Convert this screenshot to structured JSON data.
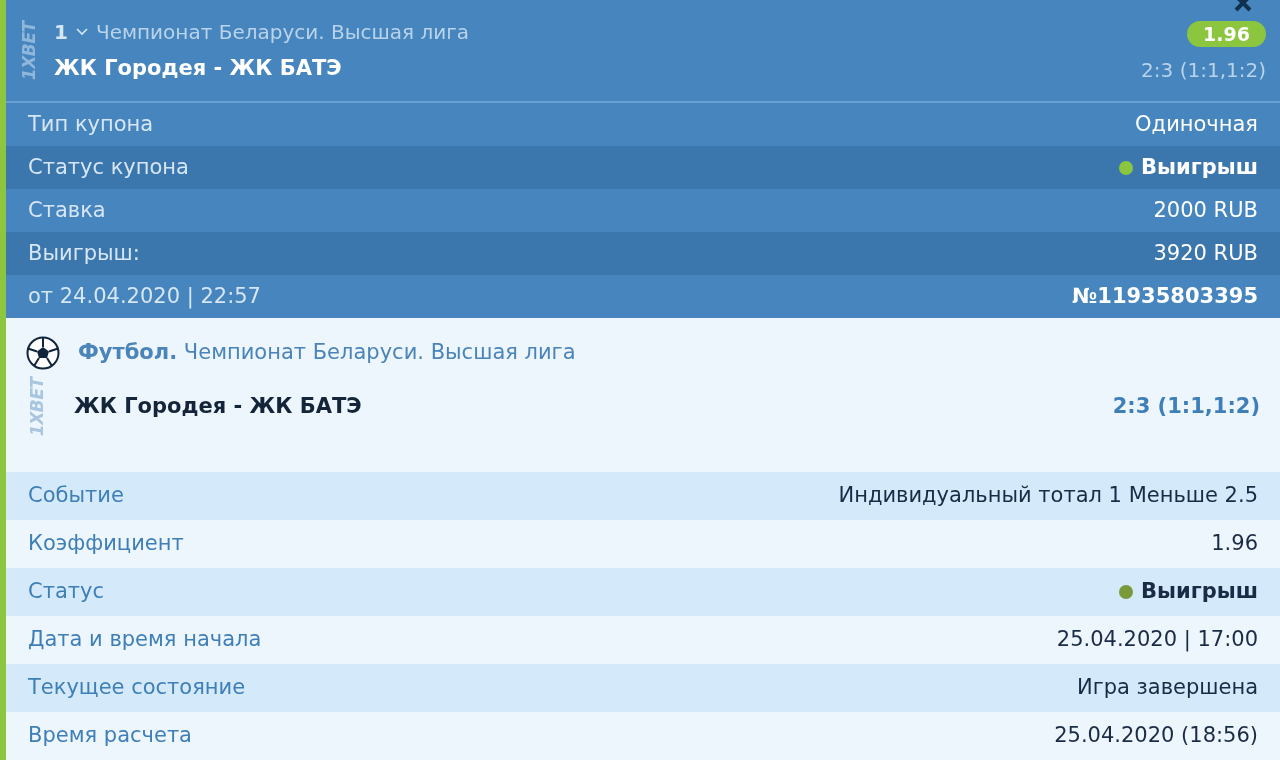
{
  "coupon": {
    "index": "1",
    "logo": "1XBET",
    "league": "Чемпионат Беларуси. Высшая лига",
    "match": "ЖК Городея - ЖК БАТЭ",
    "odds": "1.96",
    "score": "2:3 (1:1,1:2)",
    "rows": [
      {
        "kind": "plain",
        "label": "Тип купона",
        "value": "Одиночная"
      },
      {
        "kind": "status",
        "label": "Статус купона",
        "value": "Выигрыш",
        "color": "#8cc63f"
      },
      {
        "kind": "plain",
        "label": "Ставка",
        "value": "2000 RUB"
      },
      {
        "kind": "plain",
        "label": "Выигрыш:",
        "value": "3920 RUB"
      },
      {
        "kind": "number",
        "label": "от 24.04.2020 | 22:57",
        "value": "№11935803395"
      }
    ]
  },
  "event": {
    "sport": "Футбол.",
    "league": "Чемпионат Беларуси. Высшая лига",
    "logo": "1XBET",
    "match": "ЖК Городея - ЖК БАТЭ",
    "score": "2:3 (1:1,1:2)",
    "rows": [
      {
        "kind": "plain",
        "label": "Событие",
        "value": "Индивидуальный тотал 1 Меньше 2.5"
      },
      {
        "kind": "plain",
        "label": "Коэффициент",
        "value": "1.96"
      },
      {
        "kind": "status",
        "label": "Статус",
        "value": "Выигрыш",
        "color": "#7a9a3a"
      },
      {
        "kind": "plain",
        "label": "Дата и время начала",
        "value": "25.04.2020 | 17:00"
      },
      {
        "kind": "plain",
        "label": "Текущее состояние",
        "value": "Игра завершена"
      },
      {
        "kind": "plain",
        "label": "Время расчета",
        "value": "25.04.2020 (18:56)"
      }
    ]
  }
}
